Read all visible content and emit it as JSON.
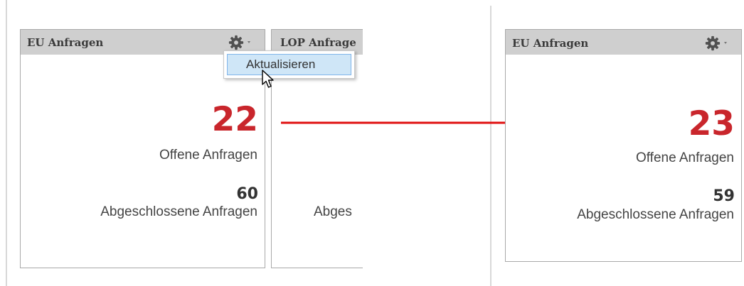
{
  "left_panel": {
    "title": "EU Anfragen",
    "open_count": "22",
    "open_label": "Offene Anfragen",
    "closed_count": "60",
    "closed_label": "Abgeschlossene Anfragen"
  },
  "middle_panel": {
    "title": "LOP Anfrage",
    "closed_label_partial": "Abges"
  },
  "dropdown": {
    "item_label": "Aktualisieren"
  },
  "right_panel": {
    "title": "EU Anfragen",
    "open_count": "23",
    "open_label": "Offene Anfragen",
    "closed_count": "59",
    "closed_label": "Abgeschlossene Anfragen"
  },
  "colors": {
    "accent_red": "#c9262c",
    "arrow_red": "#e01010",
    "header_gray": "#cfcfcf",
    "menu_highlight": "#cfe6f7"
  },
  "icons": {
    "gear": "gear-icon",
    "dropdown_caret": "caret-down-icon",
    "cursor": "mouse-pointer-icon"
  }
}
